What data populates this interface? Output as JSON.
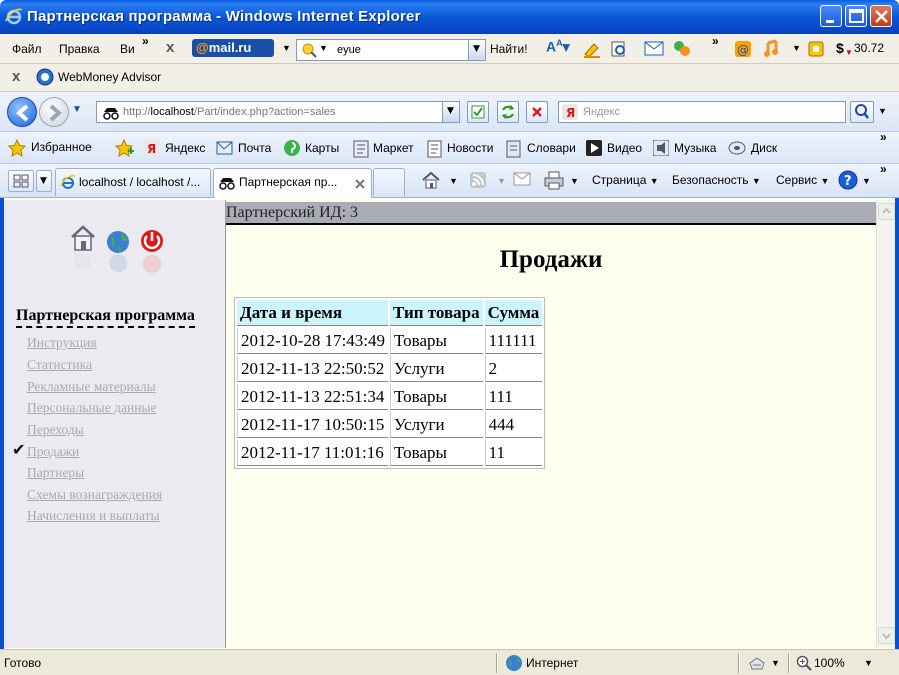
{
  "window": {
    "title": "Партнерская программа - Windows Internet Explorer"
  },
  "menu": {
    "file": "Файл",
    "edit": "Правка",
    "view": "Ви",
    "more": "»",
    "close": "x"
  },
  "mailru_toolbar": {
    "logo_at": "@",
    "logo_text": "mail.ru",
    "search_value": "eyue",
    "find_label": "Найти!",
    "more": "»",
    "balance": "30.72",
    "currency": "$"
  },
  "webmoney_bar": {
    "close": "x",
    "label": "WebMoney Advisor"
  },
  "address": {
    "url_prefix": "http://",
    "url_host": "localhost",
    "url_path": "/Part/index.php?action=sales",
    "yandex_placeholder": "Яндекс"
  },
  "favorites_bar": {
    "favorites_label": "Избранное",
    "links": [
      "Яндекс",
      "Почта",
      "Карты",
      "Маркет",
      "Новости",
      "Словари",
      "Видео",
      "Музыка",
      "Диск"
    ],
    "more": "»"
  },
  "tabs": [
    {
      "label": "localhost / localhost /...",
      "active": false
    },
    {
      "label": "Партнерская пр...",
      "active": true
    }
  ],
  "command_bar": {
    "page": "Страница",
    "safety": "Безопасность",
    "tools": "Сервис",
    "more": "»"
  },
  "page": {
    "partner_id_label": "Партнерский ИД: 3",
    "heading": "Продажи",
    "sidebar_title": "Партнерская программа",
    "sidebar_links": [
      "Инструкция",
      "Статистика",
      "Рекламные материалы",
      "Персональные данные",
      "Переходы",
      "Продажи",
      "Партнеры",
      "Схемы вознаграждения",
      "Начисления и выплаты"
    ],
    "checkmark": "✔",
    "table": {
      "headers": [
        "Дата и время",
        "Тип товара",
        "Сумма"
      ],
      "rows": [
        [
          "2012-10-28 17:43:49",
          "Товары",
          "111111"
        ],
        [
          "2012-11-13 22:50:52",
          "Услуги",
          "2"
        ],
        [
          "2012-11-13 22:51:34",
          "Товары",
          "111"
        ],
        [
          "2012-11-17 10:50:15",
          "Услуги",
          "444"
        ],
        [
          "2012-11-17 11:01:16",
          "Товары",
          "11"
        ]
      ]
    }
  },
  "status": {
    "text": "Готово",
    "zone": "Интернет",
    "zoom": "100%"
  },
  "colors": {
    "titlebar": "#0a58d8",
    "page_bg": "#fffff0",
    "sidebar_bg": "#eaeaf0",
    "table_header": "#ccf4fc",
    "idbar": "#a9acb4",
    "sidebar_link": "#a9a9b0"
  }
}
